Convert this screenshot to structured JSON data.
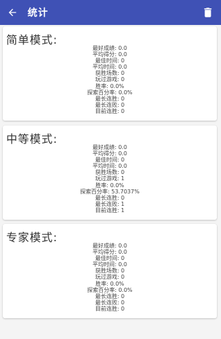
{
  "header": {
    "title": "统计"
  },
  "icons": {
    "back": "arrow-back-icon",
    "delete": "trash-icon"
  },
  "sections": [
    {
      "title": "简单模式:",
      "stats": [
        "最好成绩: 0.0",
        "平均得分: 0.0",
        "最佳时间: 0",
        "平均时间: 0.0",
        "获胜场数: 0",
        "玩过游戏: 0",
        "胜率: 0.0%",
        "探索百分率: 0.0%",
        "最长连胜: 0",
        "最长连败: 0",
        "目前连胜: 0"
      ]
    },
    {
      "title": "中等模式:",
      "stats": [
        "最好成绩: 0.0",
        "平均得分: 0.0",
        "最佳时间: 0",
        "平均时间: 0.0",
        "获胜场数: 0",
        "玩过游戏: 1",
        "胜率: 0.0%",
        "探索百分率: 53.7037%",
        "最长连胜: 0",
        "最长连败: 1",
        "目前连胜: 1"
      ]
    },
    {
      "title": "专家模式:",
      "stats": [
        "最好成绩: 0.0",
        "平均得分: 0.0",
        "最佳时间: 0",
        "平均时间: 0.0",
        "获胜场数: 0",
        "玩过游戏: 0",
        "胜率: 0.0%",
        "探索百分率: 0.0%",
        "最长连胜: 0",
        "最长连败: 0",
        "目前连胜: 0"
      ]
    }
  ]
}
